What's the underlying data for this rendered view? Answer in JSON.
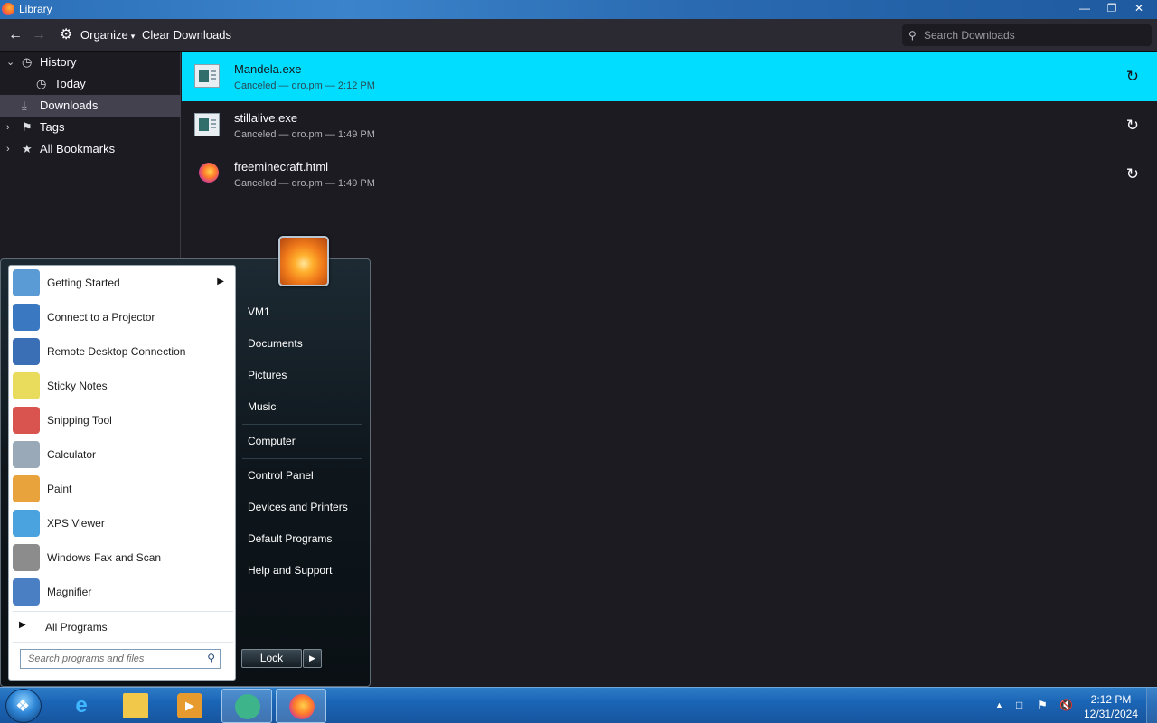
{
  "window": {
    "title": "Library"
  },
  "toolbar": {
    "organize": "Organize",
    "clear": "Clear Downloads",
    "search_placeholder": "Search Downloads"
  },
  "sidebar": {
    "items": [
      {
        "label": "History"
      },
      {
        "label": "Today"
      },
      {
        "label": "Downloads"
      },
      {
        "label": "Tags"
      },
      {
        "label": "All Bookmarks"
      }
    ]
  },
  "downloads": [
    {
      "name": "Mandela.exe",
      "status": "Canceled — dro.pm — 2:12 PM"
    },
    {
      "name": "stillalive.exe",
      "status": "Canceled — dro.pm — 1:49 PM"
    },
    {
      "name": "freeminecraft.html",
      "status": "Canceled — dro.pm — 1:49 PM"
    }
  ],
  "start_menu": {
    "programs": [
      {
        "label": "Getting Started",
        "color": "#5b9bd5"
      },
      {
        "label": "Connect to a Projector",
        "color": "#3a78c2"
      },
      {
        "label": "Remote Desktop Connection",
        "color": "#3b6fb5"
      },
      {
        "label": "Sticky Notes",
        "color": "#e9dc5c"
      },
      {
        "label": "Snipping Tool",
        "color": "#d9534f"
      },
      {
        "label": "Calculator",
        "color": "#9aa9b8"
      },
      {
        "label": "Paint",
        "color": "#e8a33d"
      },
      {
        "label": "XPS Viewer",
        "color": "#4aa3df"
      },
      {
        "label": "Windows Fax and Scan",
        "color": "#8c8c8c"
      },
      {
        "label": "Magnifier",
        "color": "#4b7fc4"
      }
    ],
    "all_programs": "All Programs",
    "search_placeholder": "Search programs and files",
    "right_items": [
      {
        "label": "VM1"
      },
      {
        "label": "Documents"
      },
      {
        "label": "Pictures"
      },
      {
        "label": "Music"
      },
      {
        "label": "Computer"
      },
      {
        "label": "Control Panel"
      },
      {
        "label": "Devices and Printers"
      },
      {
        "label": "Default Programs"
      },
      {
        "label": "Help and Support"
      }
    ],
    "lock_label": "Lock"
  },
  "taskbar": {
    "clock_time": "2:12 PM",
    "clock_date": "12/31/2024"
  }
}
